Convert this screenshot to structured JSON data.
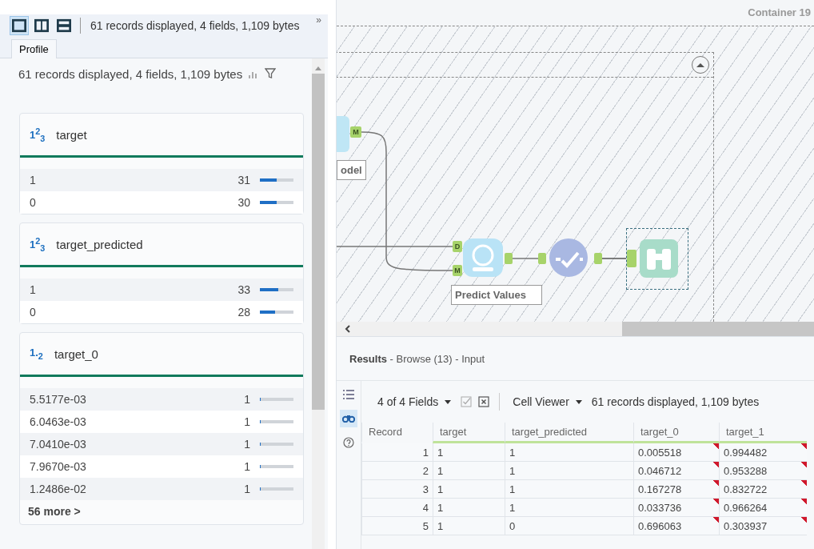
{
  "left_panel": {
    "layout_buttons": [
      {
        "kind": "single",
        "selected": true
      },
      {
        "kind": "columns",
        "selected": false
      },
      {
        "kind": "rows",
        "selected": false
      }
    ],
    "summary": "61 records displayed, 4 fields, 1,109 bytes",
    "overflow": "»",
    "tabs": [
      {
        "label": "Profile",
        "selected": true
      }
    ],
    "profile": {
      "summary": "61 records displayed, 4 fields, 1,109 bytes",
      "fields": [
        {
          "type_label": "1$^{2}$$_{3}$",
          "name": "target",
          "values": [
            {
              "value": "1",
              "count": "31",
              "level": 0.51
            },
            {
              "value": "0",
              "count": "30",
              "level": 0.49
            }
          ]
        },
        {
          "type_label": "1$^{2}$$_{3}$",
          "name": "target_predicted",
          "values": [
            {
              "value": "1",
              "count": "33",
              "level": 0.54
            },
            {
              "value": "0",
              "count": "28",
              "level": 0.46
            }
          ]
        },
        {
          "type_label": "1.$_{2}$",
          "name": "target_0",
          "values": [
            {
              "value": "5.5177e-03",
              "count": "1",
              "level": 0.03
            },
            {
              "value": "6.0463e-03",
              "count": "1",
              "level": 0.03
            },
            {
              "value": "7.0410e-03",
              "count": "1",
              "level": 0.03
            },
            {
              "value": "7.9670e-03",
              "count": "1",
              "level": 0.03
            },
            {
              "value": "1.2486e-02",
              "count": "1",
              "level": 0.03
            }
          ],
          "more": "56 more >"
        }
      ]
    }
  },
  "canvas": {
    "container_title": "Container 19",
    "model_label": "odel",
    "model_port": "M",
    "predict_ports": [
      "D",
      "M"
    ],
    "predict_label": "Predict Values"
  },
  "results": {
    "title": "**Results** - Browse (13) - Input",
    "fields_button": "4 of 4 Fields",
    "viewer_button": "Cell Viewer",
    "summary": "61 records displayed, 1,109 bytes",
    "columns": [
      {
        "label": "Record",
        "marked": false
      },
      {
        "label": "target",
        "marked": false
      },
      {
        "label": "target_predicted",
        "marked": false
      },
      {
        "label": "target_0",
        "marked": true
      },
      {
        "label": "target_1",
        "marked": true
      }
    ],
    "rows": [
      [
        "1",
        "1",
        "1",
        "0.005518",
        "0.994482"
      ],
      [
        "2",
        "1",
        "1",
        "0.046712",
        "0.953288"
      ],
      [
        "3",
        "1",
        "1",
        "0.167278",
        "0.832722"
      ],
      [
        "4",
        "1",
        "1",
        "0.033736",
        "0.966264"
      ],
      [
        "5",
        "1",
        "0",
        "0.696063",
        "0.303937"
      ]
    ]
  }
}
